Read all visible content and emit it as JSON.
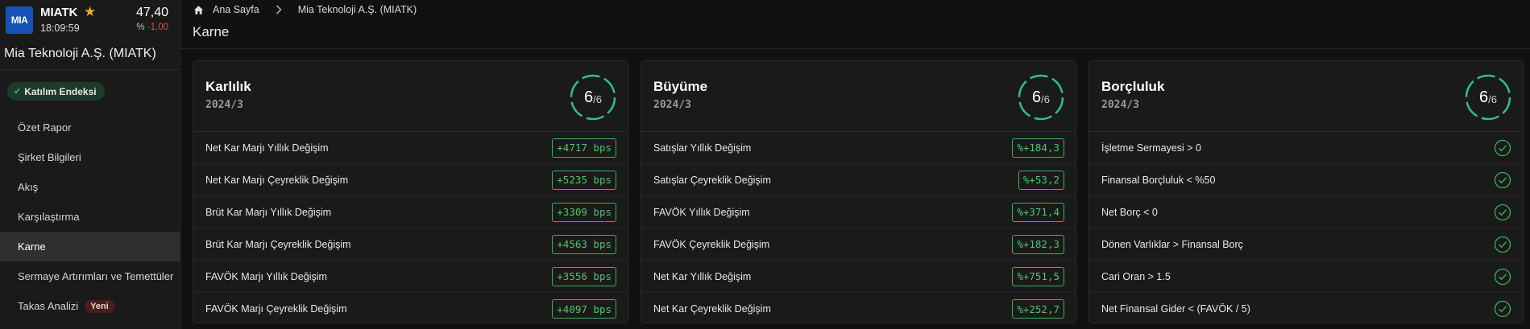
{
  "ticker": {
    "logo_text": "MIA",
    "symbol": "MIATK",
    "time": "18:09:59",
    "price": "47,40",
    "change_prefix": "%",
    "change_value": "-1,00",
    "colors": {
      "down": "#e04b4b",
      "star": "#f5a623",
      "logo_bg": "#1552b8"
    }
  },
  "company_name": "Mia Teknoloji A.Ş. (MIATK)",
  "katilim_label": "Katılım Endeksi",
  "menu": [
    {
      "label": "Özet Rapor",
      "active": false
    },
    {
      "label": "Şirket Bilgileri",
      "active": false
    },
    {
      "label": "Akış",
      "active": false
    },
    {
      "label": "Karşılaştırma",
      "active": false
    },
    {
      "label": "Karne",
      "active": true
    },
    {
      "label": "Sermaye Artırımları ve Temettüler",
      "active": false
    },
    {
      "label": "Takas Analizi",
      "active": false,
      "badge": "Yeni"
    }
  ],
  "breadcrumb": {
    "home": "Ana Sayfa",
    "current": "Mia Teknoloji A.Ş. (MIATK)"
  },
  "page_title": "Karne",
  "accent_green": "#3cae5c",
  "cards": [
    {
      "title": "Karlılık",
      "period": "2024/3",
      "score": "6",
      "score_total": "/6",
      "rows": [
        {
          "label": "Net Kar Marjı Yıllık Değişim",
          "value": "+4717 bps"
        },
        {
          "label": "Net Kar Marjı Çeyreklik Değişim",
          "value": "+5235 bps"
        },
        {
          "label": "Brüt Kar Marjı Yıllık Değişim",
          "value": "+3309 bps"
        },
        {
          "label": "Brüt Kar Marjı Çeyreklik Değişim",
          "value": "+4563 bps"
        },
        {
          "label": "FAVÖK Marjı Yıllık Değişim",
          "value": "+3556 bps"
        },
        {
          "label": "FAVÖK Marjı Çeyreklik Değişim",
          "value": "+4097 bps"
        }
      ]
    },
    {
      "title": "Büyüme",
      "period": "2024/3",
      "score": "6",
      "score_total": "/6",
      "rows": [
        {
          "label": "Satışlar Yıllık Değişim",
          "value": "%+184,3"
        },
        {
          "label": "Satışlar Çeyreklik Değişim",
          "value": "%+53,2"
        },
        {
          "label": "FAVÖK Yıllık Değişim",
          "value": "%+371,4"
        },
        {
          "label": "FAVÖK Çeyreklik Değişim",
          "value": "%+182,3"
        },
        {
          "label": "Net Kar Yıllık Değişim",
          "value": "%+751,5"
        },
        {
          "label": "Net Kar Çeyreklik Değişim",
          "value": "%+252,7"
        }
      ]
    },
    {
      "title": "Borçluluk",
      "period": "2024/3",
      "score": "6",
      "score_total": "/6",
      "rows": [
        {
          "label": "İşletme Sermayesi > 0",
          "icon": "check-circle-icon"
        },
        {
          "label": "Finansal Borçluluk < %50",
          "icon": "check-circle-icon"
        },
        {
          "label": "Net Borç < 0",
          "icon": "check-circle-icon"
        },
        {
          "label": "Dönen Varlıklar > Finansal Borç",
          "icon": "check-circle-icon"
        },
        {
          "label": "Cari Oran > 1.5",
          "icon": "check-circle-icon"
        },
        {
          "label": "Net Finansal Gider < (FAVÖK / 5)",
          "icon": "check-circle-icon"
        }
      ]
    }
  ]
}
